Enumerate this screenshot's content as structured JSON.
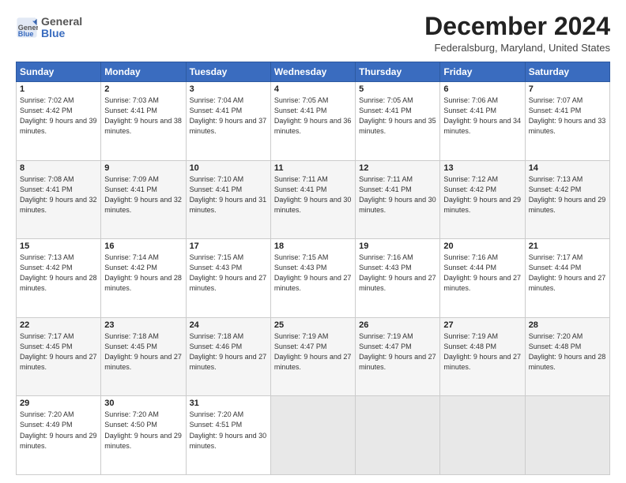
{
  "header": {
    "logo_line1": "General",
    "logo_line2": "Blue",
    "title": "December 2024",
    "location": "Federalsburg, Maryland, United States"
  },
  "days_of_week": [
    "Sunday",
    "Monday",
    "Tuesday",
    "Wednesday",
    "Thursday",
    "Friday",
    "Saturday"
  ],
  "weeks": [
    [
      {
        "day": "1",
        "sunrise": "Sunrise: 7:02 AM",
        "sunset": "Sunset: 4:42 PM",
        "daylight": "Daylight: 9 hours and 39 minutes."
      },
      {
        "day": "2",
        "sunrise": "Sunrise: 7:03 AM",
        "sunset": "Sunset: 4:41 PM",
        "daylight": "Daylight: 9 hours and 38 minutes."
      },
      {
        "day": "3",
        "sunrise": "Sunrise: 7:04 AM",
        "sunset": "Sunset: 4:41 PM",
        "daylight": "Daylight: 9 hours and 37 minutes."
      },
      {
        "day": "4",
        "sunrise": "Sunrise: 7:05 AM",
        "sunset": "Sunset: 4:41 PM",
        "daylight": "Daylight: 9 hours and 36 minutes."
      },
      {
        "day": "5",
        "sunrise": "Sunrise: 7:05 AM",
        "sunset": "Sunset: 4:41 PM",
        "daylight": "Daylight: 9 hours and 35 minutes."
      },
      {
        "day": "6",
        "sunrise": "Sunrise: 7:06 AM",
        "sunset": "Sunset: 4:41 PM",
        "daylight": "Daylight: 9 hours and 34 minutes."
      },
      {
        "day": "7",
        "sunrise": "Sunrise: 7:07 AM",
        "sunset": "Sunset: 4:41 PM",
        "daylight": "Daylight: 9 hours and 33 minutes."
      }
    ],
    [
      {
        "day": "8",
        "sunrise": "Sunrise: 7:08 AM",
        "sunset": "Sunset: 4:41 PM",
        "daylight": "Daylight: 9 hours and 32 minutes."
      },
      {
        "day": "9",
        "sunrise": "Sunrise: 7:09 AM",
        "sunset": "Sunset: 4:41 PM",
        "daylight": "Daylight: 9 hours and 32 minutes."
      },
      {
        "day": "10",
        "sunrise": "Sunrise: 7:10 AM",
        "sunset": "Sunset: 4:41 PM",
        "daylight": "Daylight: 9 hours and 31 minutes."
      },
      {
        "day": "11",
        "sunrise": "Sunrise: 7:11 AM",
        "sunset": "Sunset: 4:41 PM",
        "daylight": "Daylight: 9 hours and 30 minutes."
      },
      {
        "day": "12",
        "sunrise": "Sunrise: 7:11 AM",
        "sunset": "Sunset: 4:41 PM",
        "daylight": "Daylight: 9 hours and 30 minutes."
      },
      {
        "day": "13",
        "sunrise": "Sunrise: 7:12 AM",
        "sunset": "Sunset: 4:42 PM",
        "daylight": "Daylight: 9 hours and 29 minutes."
      },
      {
        "day": "14",
        "sunrise": "Sunrise: 7:13 AM",
        "sunset": "Sunset: 4:42 PM",
        "daylight": "Daylight: 9 hours and 29 minutes."
      }
    ],
    [
      {
        "day": "15",
        "sunrise": "Sunrise: 7:13 AM",
        "sunset": "Sunset: 4:42 PM",
        "daylight": "Daylight: 9 hours and 28 minutes."
      },
      {
        "day": "16",
        "sunrise": "Sunrise: 7:14 AM",
        "sunset": "Sunset: 4:42 PM",
        "daylight": "Daylight: 9 hours and 28 minutes."
      },
      {
        "day": "17",
        "sunrise": "Sunrise: 7:15 AM",
        "sunset": "Sunset: 4:43 PM",
        "daylight": "Daylight: 9 hours and 27 minutes."
      },
      {
        "day": "18",
        "sunrise": "Sunrise: 7:15 AM",
        "sunset": "Sunset: 4:43 PM",
        "daylight": "Daylight: 9 hours and 27 minutes."
      },
      {
        "day": "19",
        "sunrise": "Sunrise: 7:16 AM",
        "sunset": "Sunset: 4:43 PM",
        "daylight": "Daylight: 9 hours and 27 minutes."
      },
      {
        "day": "20",
        "sunrise": "Sunrise: 7:16 AM",
        "sunset": "Sunset: 4:44 PM",
        "daylight": "Daylight: 9 hours and 27 minutes."
      },
      {
        "day": "21",
        "sunrise": "Sunrise: 7:17 AM",
        "sunset": "Sunset: 4:44 PM",
        "daylight": "Daylight: 9 hours and 27 minutes."
      }
    ],
    [
      {
        "day": "22",
        "sunrise": "Sunrise: 7:17 AM",
        "sunset": "Sunset: 4:45 PM",
        "daylight": "Daylight: 9 hours and 27 minutes."
      },
      {
        "day": "23",
        "sunrise": "Sunrise: 7:18 AM",
        "sunset": "Sunset: 4:45 PM",
        "daylight": "Daylight: 9 hours and 27 minutes."
      },
      {
        "day": "24",
        "sunrise": "Sunrise: 7:18 AM",
        "sunset": "Sunset: 4:46 PM",
        "daylight": "Daylight: 9 hours and 27 minutes."
      },
      {
        "day": "25",
        "sunrise": "Sunrise: 7:19 AM",
        "sunset": "Sunset: 4:47 PM",
        "daylight": "Daylight: 9 hours and 27 minutes."
      },
      {
        "day": "26",
        "sunrise": "Sunrise: 7:19 AM",
        "sunset": "Sunset: 4:47 PM",
        "daylight": "Daylight: 9 hours and 27 minutes."
      },
      {
        "day": "27",
        "sunrise": "Sunrise: 7:19 AM",
        "sunset": "Sunset: 4:48 PM",
        "daylight": "Daylight: 9 hours and 27 minutes."
      },
      {
        "day": "28",
        "sunrise": "Sunrise: 7:20 AM",
        "sunset": "Sunset: 4:48 PM",
        "daylight": "Daylight: 9 hours and 28 minutes."
      }
    ],
    [
      {
        "day": "29",
        "sunrise": "Sunrise: 7:20 AM",
        "sunset": "Sunset: 4:49 PM",
        "daylight": "Daylight: 9 hours and 29 minutes."
      },
      {
        "day": "30",
        "sunrise": "Sunrise: 7:20 AM",
        "sunset": "Sunset: 4:50 PM",
        "daylight": "Daylight: 9 hours and 29 minutes."
      },
      {
        "day": "31",
        "sunrise": "Sunrise: 7:20 AM",
        "sunset": "Sunset: 4:51 PM",
        "daylight": "Daylight: 9 hours and 30 minutes."
      },
      null,
      null,
      null,
      null
    ]
  ]
}
